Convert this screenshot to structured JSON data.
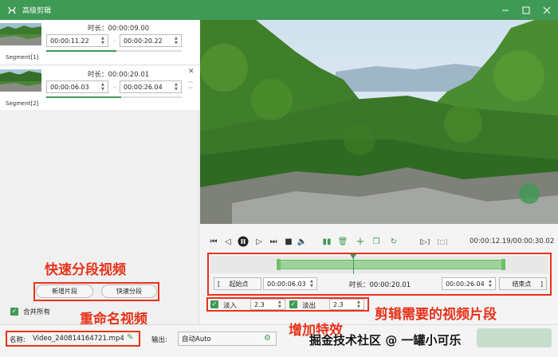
{
  "window": {
    "title": "高级剪辑"
  },
  "segments": [
    {
      "label": "Segment[1]",
      "duration": "时长：00:00:09.00",
      "start": "00:00:11.22",
      "end": "00:00:20.22",
      "progress": 0.52
    },
    {
      "label": "Segment[2]",
      "duration": "时长：00:00:20.01",
      "start": "00:00:06.03",
      "end": "00:00:26.04",
      "progress": 0.55
    }
  ],
  "left_controls": {
    "add_segment": "新增片段",
    "quick_segment": "快速分段",
    "merge_all": "合并所有"
  },
  "bottom": {
    "name_label": "名称:",
    "name_value": "Video_240814164721.mp4",
    "output_label": "输出:",
    "output_value": "自动Auto"
  },
  "player": {
    "time_display": "00:00:12.19/00:00:30.02",
    "playhead_fraction": 0.422
  },
  "trim": {
    "start_label": "起始点",
    "start_value": "00:00:06.03",
    "duration_text": "时长：00:00:20.01",
    "end_value": "00:00:26.04",
    "end_label": "结束点",
    "range_start_fraction": 0.2,
    "range_end_fraction": 0.867
  },
  "effects": {
    "fade_in_label": "淡入",
    "fade_in_value": "2.3",
    "fade_out_label": "淡出",
    "fade_out_value": "2.3"
  },
  "annotations": {
    "quick_segment": "快速分段视频",
    "rename": "重命名视频",
    "add_effects": "增加特效",
    "clip_segment": "剪辑需要的视频片段"
  },
  "watermark": "掘金技术社区 @ 一罐小可乐",
  "colors": {
    "accent": "#3f9a55",
    "annotation": "#e8331a"
  }
}
